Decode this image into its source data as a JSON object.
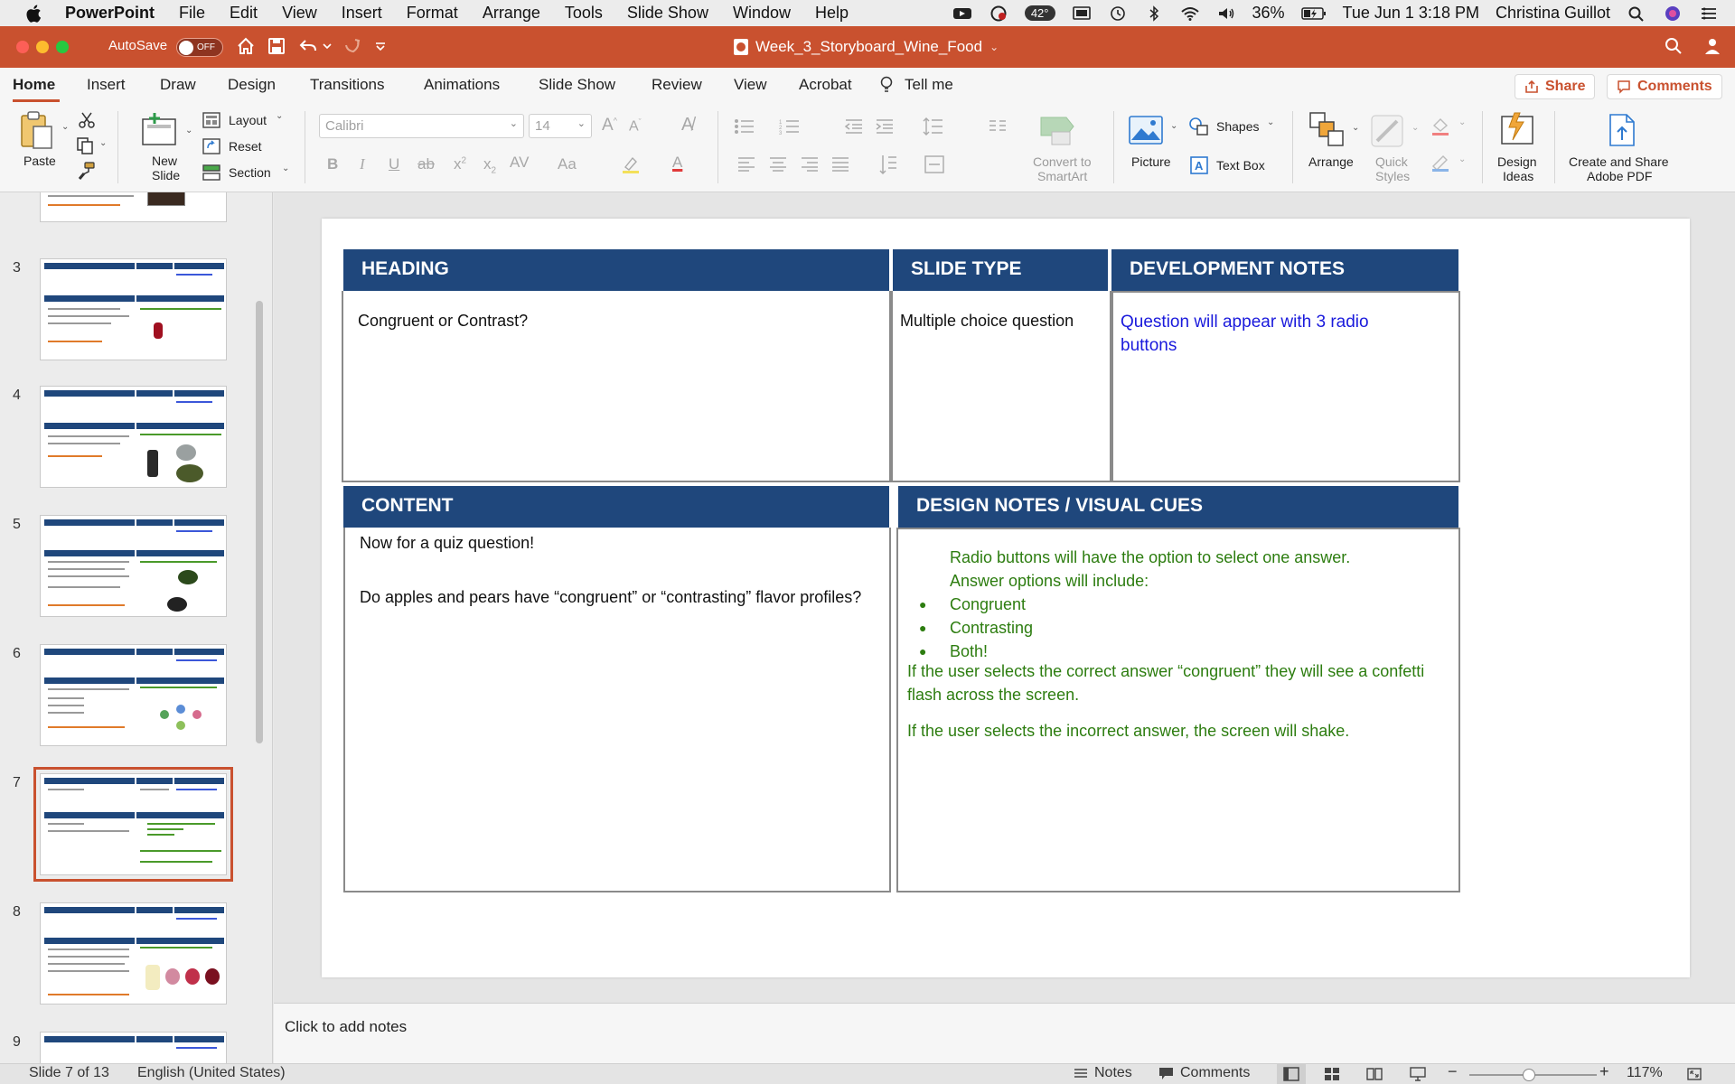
{
  "menubar": {
    "app_name": "PowerPoint",
    "items": [
      "File",
      "Edit",
      "View",
      "Insert",
      "Format",
      "Arrange",
      "Tools",
      "Slide Show",
      "Window",
      "Help"
    ],
    "temperature": "42°",
    "battery": "36%",
    "datetime": "Tue Jun 1  3:18 PM",
    "user": "Christina Guillot"
  },
  "titlebar": {
    "autosave_label": "AutoSave",
    "autosave_state": "OFF",
    "document_title": "Week_3_Storyboard_Wine_Food",
    "accent_color": "#c9512f"
  },
  "ribbon_tabs": {
    "tabs": [
      "Home",
      "Insert",
      "Draw",
      "Design",
      "Transitions",
      "Animations",
      "Slide Show",
      "Review",
      "View",
      "Acrobat",
      "Tell me"
    ],
    "active": "Home",
    "share_label": "Share",
    "comments_label": "Comments"
  },
  "ribbon": {
    "paste": "Paste",
    "new_slide_line1": "New",
    "new_slide_line2": "Slide",
    "layout": "Layout",
    "reset": "Reset",
    "section": "Section",
    "font_name": "Calibri",
    "font_size": "14",
    "convert_smartart_line1": "Convert to",
    "convert_smartart_line2": "SmartArt",
    "picture": "Picture",
    "shapes": "Shapes",
    "text_box": "Text Box",
    "arrange": "Arrange",
    "quick_styles_line1": "Quick",
    "quick_styles_line2": "Styles",
    "design_ideas_line1": "Design",
    "design_ideas_line2": "Ideas",
    "create_pdf_line1": "Create and Share",
    "create_pdf_line2": "Adobe PDF"
  },
  "thumbnails": {
    "numbers": [
      "3",
      "4",
      "5",
      "6",
      "7",
      "8",
      "9"
    ],
    "selected": "7"
  },
  "slide": {
    "heading_header": "HEADING",
    "slide_type_header": "SLIDE TYPE",
    "dev_notes_header": "DEVELOPMENT NOTES",
    "heading_text": "Congruent or Contrast?",
    "slide_type_text": "Multiple choice question",
    "dev_notes_text": "Question will appear with 3 radio buttons",
    "content_header": "CONTENT",
    "design_header": "DESIGN NOTES / VISUAL CUES",
    "content_line1": "Now for a quiz question!",
    "content_line2": "Do apples and pears have “congruent” or “contrasting” flavor profiles?",
    "design_intro1": "Radio buttons will have the option to select one answer.",
    "design_intro2": "Answer options will include:",
    "design_options": [
      "Congruent",
      "Contrasting",
      "Both!"
    ],
    "design_correct": "If the user selects the correct answer “congruent” they will see a confetti flash across the screen.",
    "design_incorrect": "If the user selects the incorrect answer, the screen will shake.",
    "header_color": "#1f477c",
    "green_text_color": "#2d7d10",
    "blue_text_color": "#1a1adc"
  },
  "notes": {
    "placeholder": "Click to add notes"
  },
  "statusbar": {
    "slide_position": "Slide 7 of 13",
    "language": "English (United States)",
    "notes_label": "Notes",
    "comments_label": "Comments",
    "zoom": "117%"
  }
}
